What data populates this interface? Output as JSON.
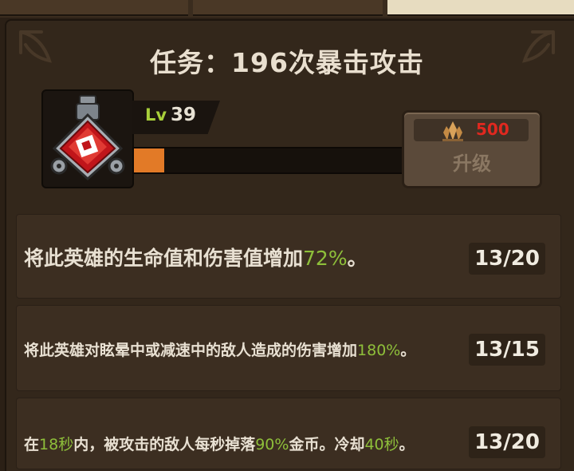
{
  "quest": {
    "prefix": "任务：",
    "text": "196次暴击攻击"
  },
  "hero_upgrade": {
    "icon": "potion-crit-icon",
    "level_label": "Lv",
    "level": "39",
    "progress_fraction": 0.11,
    "cost_icon": "crystal-icon",
    "cost": "500",
    "upgrade_label": "升级"
  },
  "skills": [
    {
      "text_before": "将此英雄的生命值和伤害值增加",
      "highlight": "72%",
      "text_after": "。",
      "count": "13/20"
    },
    {
      "text_before": "将此英雄对眩晕中或减速中的敌人造成的伤害增加",
      "highlight": "180%",
      "text_after": "。",
      "count": "13/15"
    },
    {
      "text_pre": "在",
      "hl1": "18秒",
      "text_mid1": "内，被攻击的敌人每秒掉落",
      "hl2": "90%",
      "text_mid2": "金币。冷却",
      "hl3": "40秒",
      "text_end": "。",
      "count": "13/20"
    }
  ],
  "colors": {
    "highlight": "#8ebf3a",
    "level_label": "#a8cf3a",
    "cost": "#e0281f",
    "progress": "#e27a27"
  }
}
